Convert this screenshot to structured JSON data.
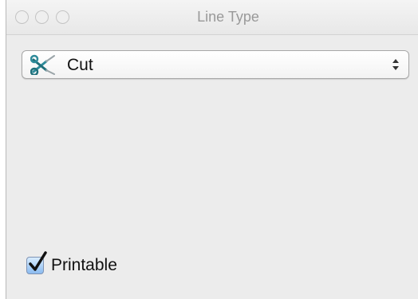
{
  "window": {
    "title": "Line Type"
  },
  "line_type_popup": {
    "selected_label": "Cut",
    "icon": "scissors-icon"
  },
  "printable_checkbox": {
    "label": "Printable",
    "checked": true
  },
  "colors": {
    "window_bg": "#ececec",
    "checkbox_accent": "#3a78d4",
    "scissors_accent": "#2e8b9a"
  }
}
